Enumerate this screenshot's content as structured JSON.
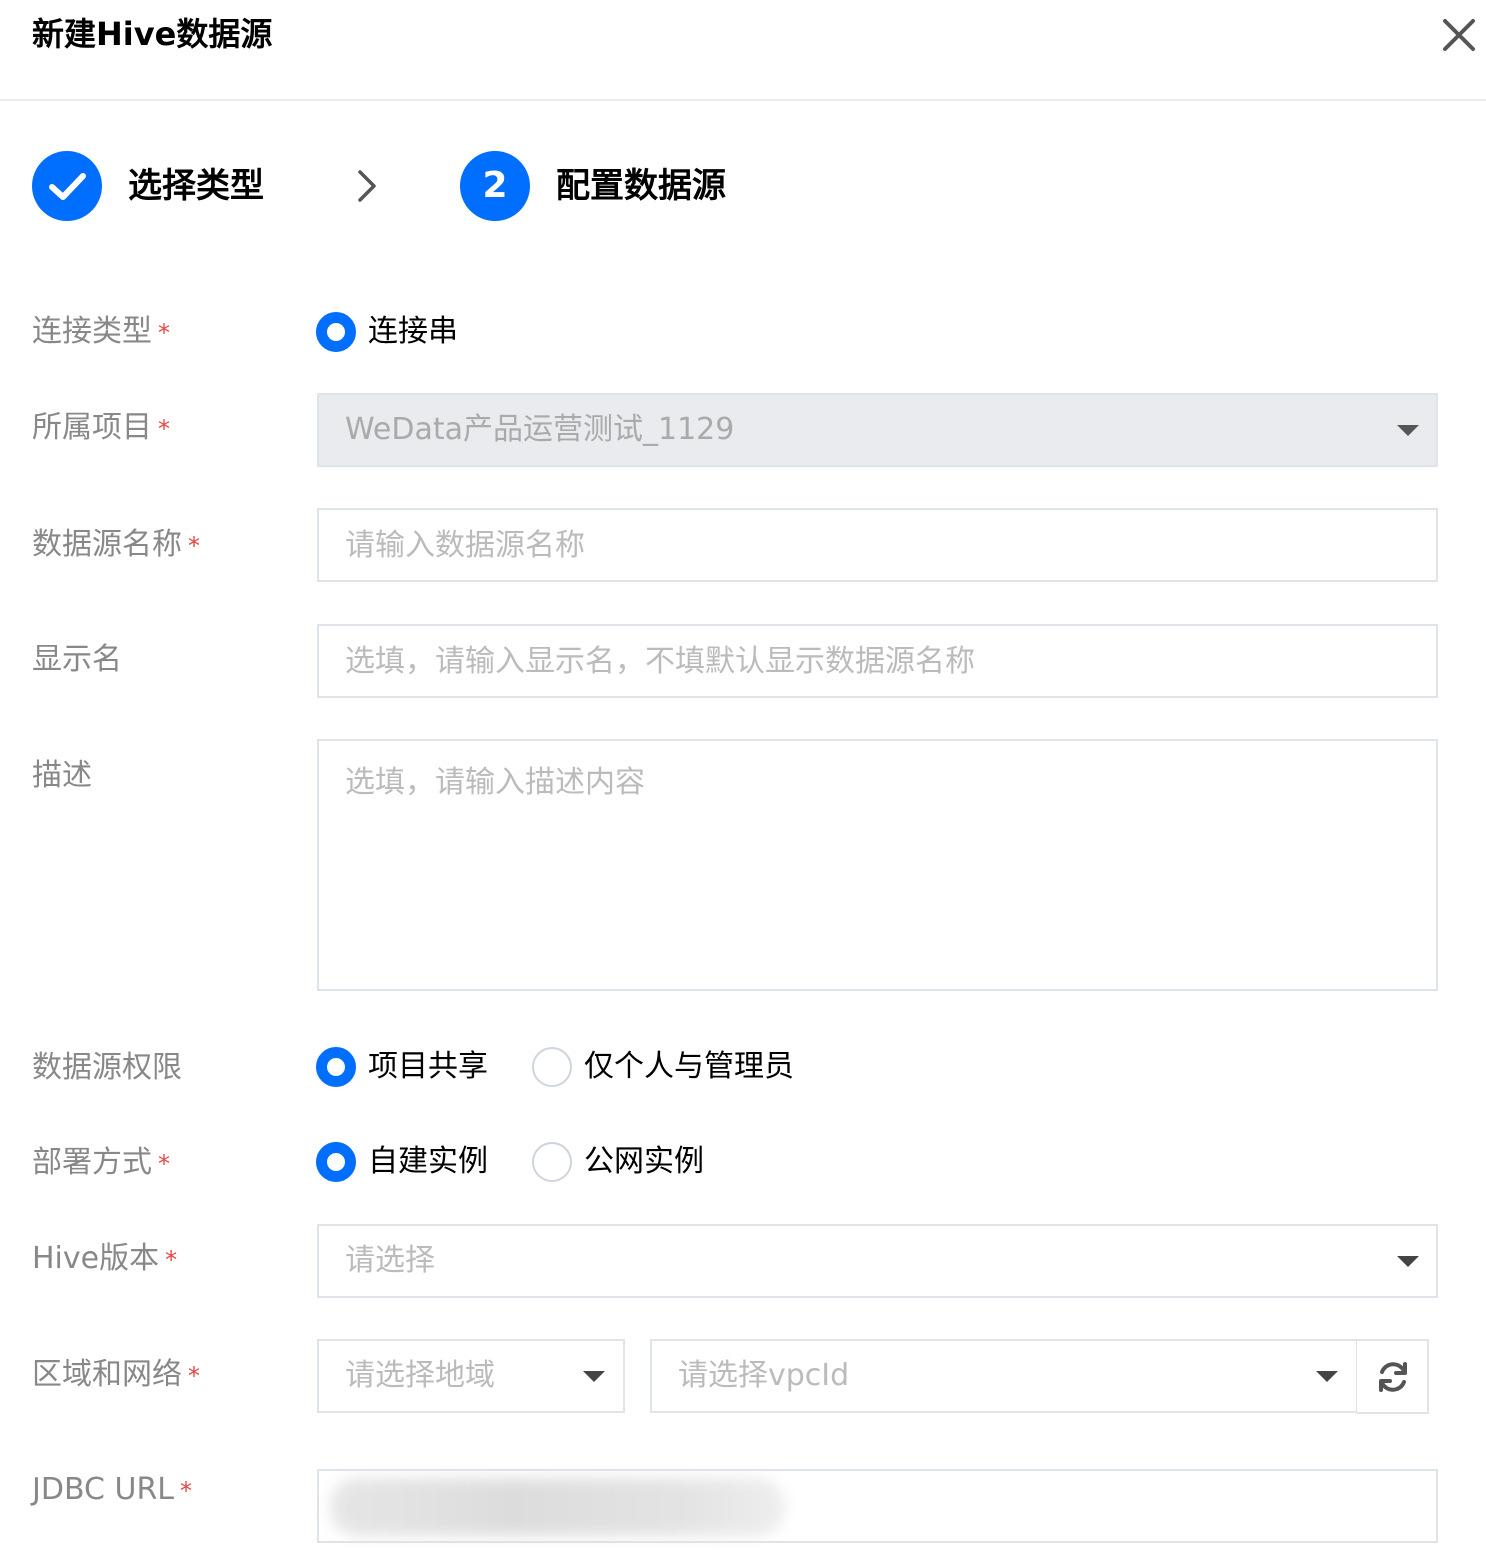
{
  "dialog": {
    "title": "新建Hive数据源",
    "close_icon": "close-icon"
  },
  "steps": [
    {
      "label": "选择类型",
      "state": "done",
      "icon": "check-icon"
    },
    {
      "label": "配置数据源",
      "number": "2",
      "state": "active"
    }
  ],
  "required_mark": "*",
  "form": {
    "connection_type": {
      "label": "连接类型",
      "required": true,
      "options": [
        "连接串"
      ],
      "selected": "连接串"
    },
    "project": {
      "label": "所属项目",
      "required": true,
      "value": "WeData产品运营测试_1129",
      "disabled": true
    },
    "datasource_name": {
      "label": "数据源名称",
      "required": true,
      "placeholder": "请输入数据源名称",
      "value": ""
    },
    "display_name": {
      "label": "显示名",
      "required": false,
      "placeholder": "选填，请输入显示名，不填默认显示数据源名称",
      "value": ""
    },
    "description": {
      "label": "描述",
      "required": false,
      "placeholder": "选填，请输入描述内容",
      "value": ""
    },
    "permission": {
      "label": "数据源权限",
      "required": false,
      "options": [
        "项目共享",
        "仅个人与管理员"
      ],
      "selected": "项目共享"
    },
    "deployment": {
      "label": "部署方式",
      "required": true,
      "options": [
        "自建实例",
        "公网实例"
      ],
      "selected": "自建实例"
    },
    "hive_version": {
      "label": "Hive版本",
      "required": true,
      "placeholder": "请选择"
    },
    "region_network": {
      "label": "区域和网络",
      "required": true,
      "region_placeholder": "请选择地域",
      "vpc_placeholder": "请选择vpcId"
    },
    "jdbc_url": {
      "label": "JDBC URL",
      "required": true,
      "value_state": "blurred"
    }
  },
  "colors": {
    "accent": "#006eff",
    "required": "#e54545",
    "label": "#888888",
    "placeholder": "#bbbbbb",
    "border": "#dfe3ea",
    "disabled_bg": "#e9ebef"
  }
}
